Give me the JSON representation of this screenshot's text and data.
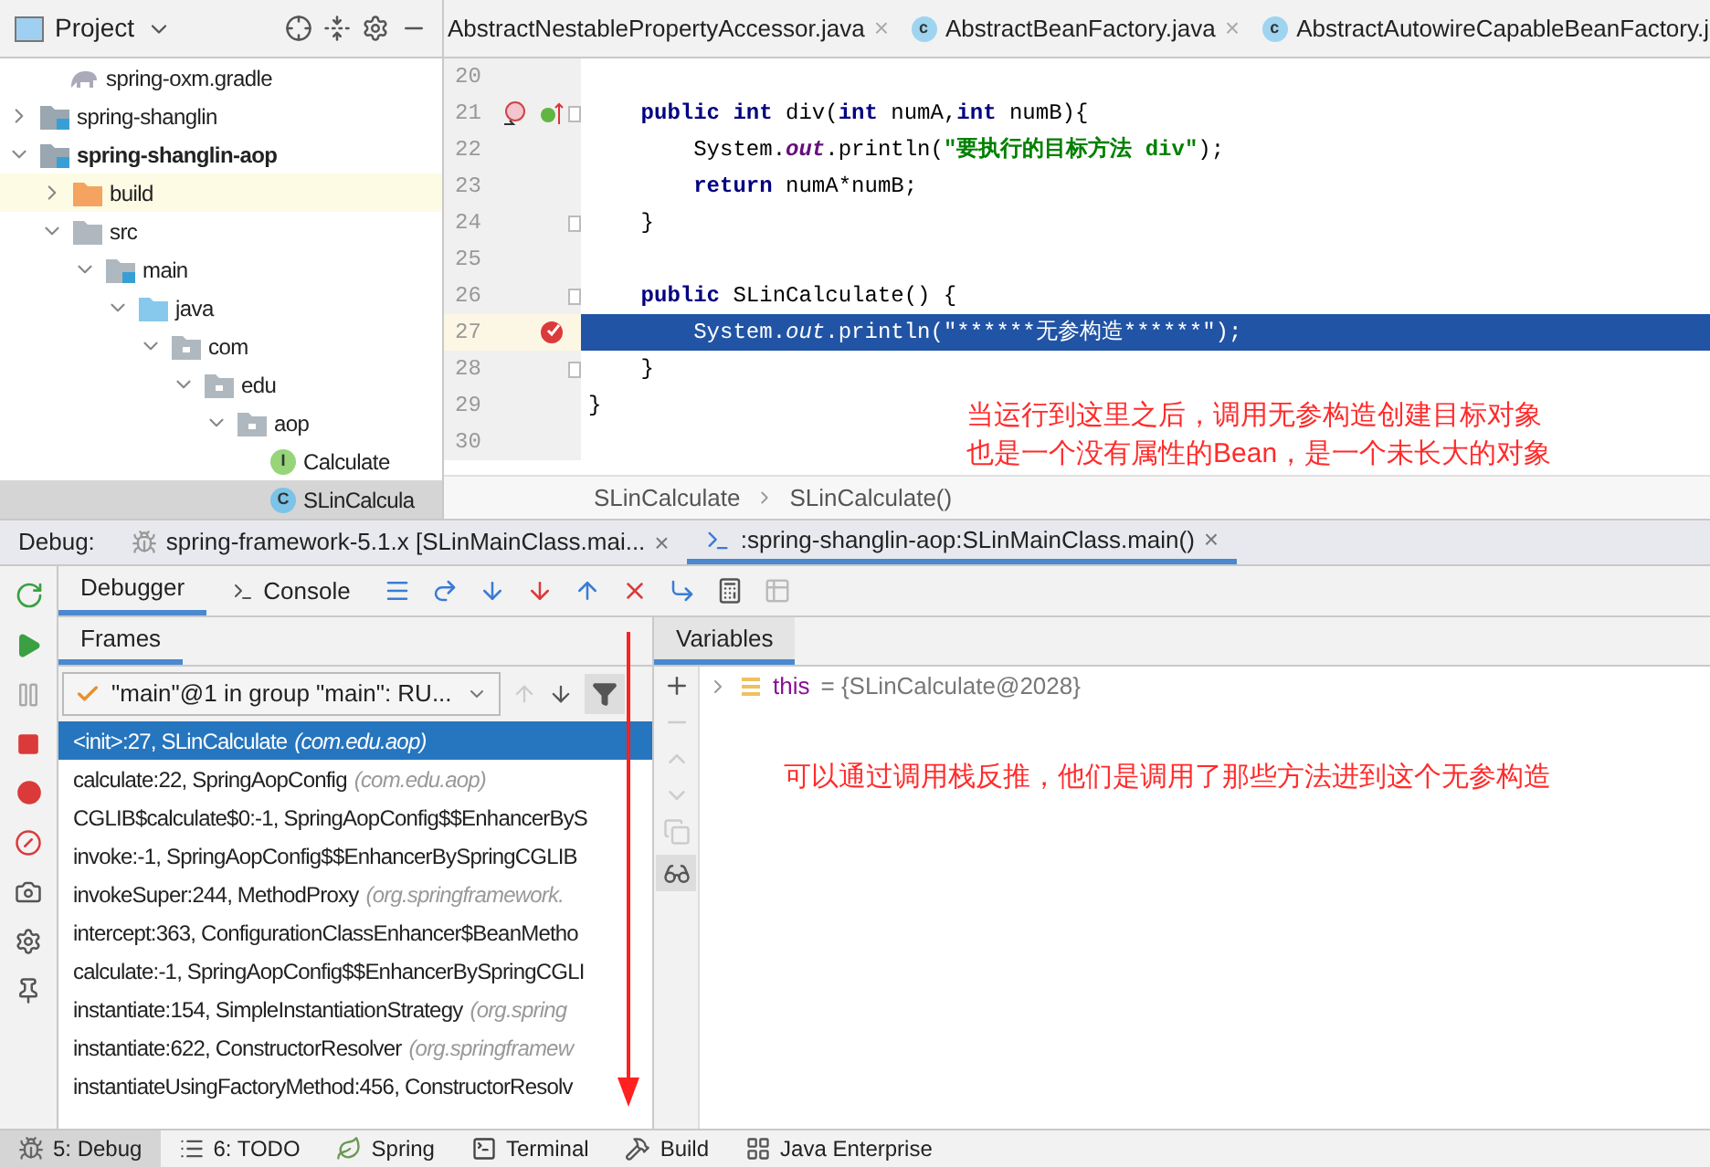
{
  "project_panel": {
    "title": "Project",
    "tree": [
      {
        "label": "spring-oxm.gradle",
        "kind": "gradle",
        "selected": false
      },
      {
        "label": "spring-shanglin",
        "kind": "module",
        "expanded": false,
        "selected": false,
        "bold": false
      },
      {
        "label": "spring-shanglin-aop",
        "kind": "module",
        "expanded": true,
        "selected": false,
        "bold": true,
        "children": [
          {
            "label": "build",
            "kind": "excluded",
            "expanded": false,
            "selected": false
          },
          {
            "label": "src",
            "kind": "folder",
            "expanded": true,
            "selected": false,
            "children": [
              {
                "label": "main",
                "kind": "module_folder",
                "expanded": true,
                "selected": false,
                "children": [
                  {
                    "label": "java",
                    "kind": "source",
                    "expanded": true,
                    "selected": false,
                    "children": [
                      {
                        "label": "com",
                        "kind": "package",
                        "expanded": true,
                        "selected": false,
                        "children": [
                          {
                            "label": "edu",
                            "kind": "package",
                            "expanded": true,
                            "selected": false,
                            "children": [
                              {
                                "label": "aop",
                                "kind": "package",
                                "expanded": true,
                                "selected": false,
                                "children": [
                                  {
                                    "label": "Calculate",
                                    "kind": "interface",
                                    "badge": "I",
                                    "selected": false
                                  },
                                  {
                                    "label": "SLinCalcula",
                                    "kind": "class",
                                    "badge": "C",
                                    "selected": true
                                  }
                                ]
                              }
                            ]
                          }
                        ]
                      }
                    ]
                  }
                ]
              }
            ]
          }
        ]
      }
    ]
  },
  "editor": {
    "tabs": [
      {
        "label": "AbstractNestablePropertyAccessor.java",
        "selected": false,
        "close": "×"
      },
      {
        "label": "AbstractBeanFactory.java",
        "badge": "c",
        "selected": false,
        "close": "×"
      },
      {
        "label": "AbstractAutowireCapableBeanFactory.j",
        "badge": "c",
        "selected": false
      }
    ],
    "lines": [
      {
        "number": "20",
        "current": false,
        "fold": false
      },
      {
        "number": "21",
        "current": false,
        "fold": true,
        "markers": [
          {
            "kind": "override"
          },
          {
            "kind": "implements"
          }
        ],
        "tokens": [
          {
            "kind": "keyword",
            "text": "    public int"
          },
          {
            "kind": "plain",
            "text": " div("
          },
          {
            "kind": "keyword",
            "text": "int"
          },
          {
            "kind": "plain",
            "text": " numA,"
          },
          {
            "kind": "keyword",
            "text": "int"
          },
          {
            "kind": "plain",
            "text": " numB){"
          }
        ]
      },
      {
        "number": "22",
        "current": false,
        "fold": false,
        "tokens": [
          {
            "kind": "plain",
            "text": "        System."
          },
          {
            "kind": "static",
            "text": "out"
          },
          {
            "kind": "plain",
            "text": ".println("
          },
          {
            "kind": "string",
            "text": "\"要执行的目标方法 div\""
          },
          {
            "kind": "plain",
            "text": ");"
          }
        ]
      },
      {
        "number": "23",
        "current": false,
        "fold": false,
        "tokens": [
          {
            "kind": "keyword",
            "text": "        return"
          },
          {
            "kind": "plain",
            "text": " numA*numB;"
          }
        ]
      },
      {
        "number": "24",
        "current": false,
        "fold": true,
        "tokens": [
          {
            "kind": "plain",
            "text": "    }"
          }
        ]
      },
      {
        "number": "25",
        "current": false,
        "fold": false
      },
      {
        "number": "26",
        "current": false,
        "fold": true,
        "tokens": [
          {
            "kind": "keyword",
            "text": "    public"
          },
          {
            "kind": "plain",
            "text": " SLinCalculate() {"
          }
        ]
      },
      {
        "number": "27",
        "current": true,
        "fold": false,
        "markers": [
          {
            "kind": "breakpoint"
          }
        ],
        "tokens": [
          {
            "kind": "plain",
            "text": "        System."
          },
          {
            "kind": "static",
            "text": "out"
          },
          {
            "kind": "plain",
            "text": ".println("
          },
          {
            "kind": "string",
            "text": "\"******无参构造******\""
          },
          {
            "kind": "plain",
            "text": ");"
          }
        ]
      },
      {
        "number": "28",
        "current": false,
        "fold": true,
        "tokens": [
          {
            "kind": "plain",
            "text": "    }"
          }
        ]
      },
      {
        "number": "29",
        "current": false,
        "fold": false,
        "tokens": [
          {
            "kind": "plain",
            "text": "}"
          }
        ]
      },
      {
        "number": "30",
        "current": false,
        "fold": false
      }
    ],
    "annotation": [
      "当运行到这里之后，调用无参构造创建目标对象",
      "也是一个没有属性的Bean，是一个未长大的对象"
    ],
    "breadcrumb": [
      "SLinCalculate",
      "SLinCalculate()"
    ]
  },
  "debug": {
    "label": "Debug:",
    "sessions": [
      {
        "label": "spring-framework-5.1.x [SLinMainClass.mai...",
        "selected": false,
        "close": "×"
      },
      {
        "label": ":spring-shanglin-aop:SLinMainClass.main()",
        "selected": true,
        "close": "×"
      }
    ],
    "tabs": [
      {
        "label": "Debugger",
        "selected": true
      },
      {
        "label": "Console",
        "selected": false
      }
    ],
    "frames_title": "Frames",
    "thread": "\"main\"@1 in group \"main\": RU...",
    "frames": [
      {
        "method": "<init>:27, SLinCalculate",
        "package": "(com.edu.aop)",
        "selected": true
      },
      {
        "method": "calculate:22, SpringAopConfig",
        "package": "(com.edu.aop)",
        "selected": false
      },
      {
        "method": "CGLIB$calculate$0:-1, SpringAopConfig$$EnhancerByS",
        "selected": false
      },
      {
        "method": "invoke:-1, SpringAopConfig$$EnhancerBySpringCGLIB",
        "selected": false
      },
      {
        "method": "invokeSuper:244, MethodProxy",
        "package": "(org.springframework.",
        "selected": false
      },
      {
        "method": "intercept:363, ConfigurationClassEnhancer$BeanMetho",
        "selected": false
      },
      {
        "method": "calculate:-1, SpringAopConfig$$EnhancerBySpringCGLI",
        "selected": false
      },
      {
        "method": "instantiate:154, SimpleInstantiationStrategy",
        "package": "(org.spring",
        "selected": false
      },
      {
        "method": "instantiate:622, ConstructorResolver",
        "package": "(org.springframew",
        "selected": false
      },
      {
        "method": "instantiateUsingFactoryMethod:456, ConstructorResolv",
        "selected": false
      }
    ],
    "variables_title": "Variables",
    "variables": [
      {
        "name": "this",
        "value": "= {SLinCalculate@2028}",
        "expanded": false
      }
    ],
    "annotation": "可以通过调用栈反推，他们是调用了那些方法进到这个无参构造"
  },
  "status_bar": [
    {
      "label": "5: Debug",
      "selected": true
    },
    {
      "label": "6: TODO",
      "selected": false
    },
    {
      "label": "Spring",
      "selected": false
    },
    {
      "label": "Terminal",
      "selected": false
    },
    {
      "label": "Build",
      "selected": false
    },
    {
      "label": "Java Enterprise",
      "selected": false
    }
  ]
}
